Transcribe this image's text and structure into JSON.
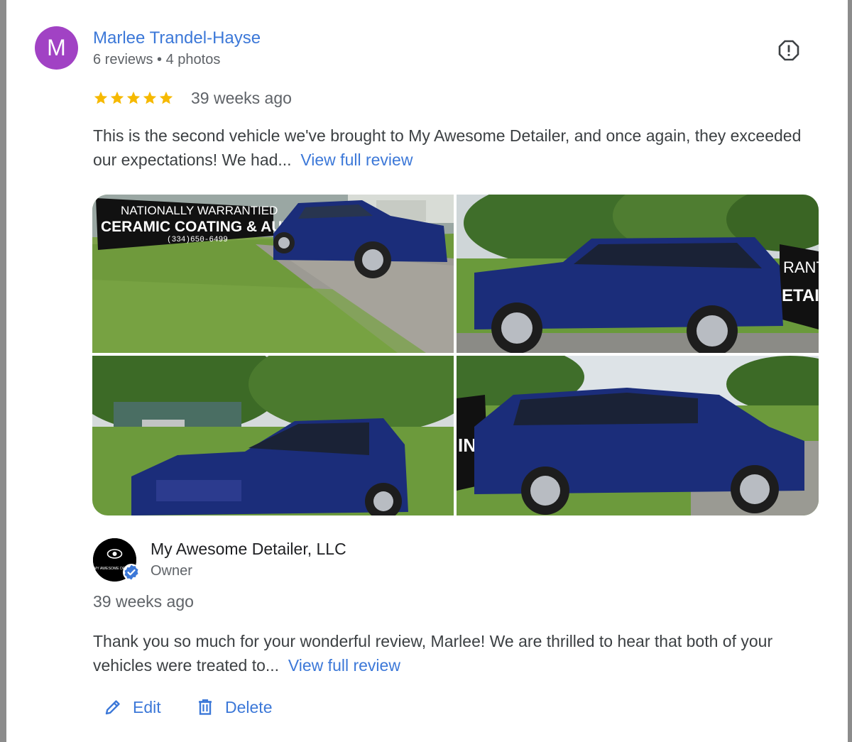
{
  "review": {
    "avatar_letter": "M",
    "reviewer_name": "Marlee Trandel-Hayse",
    "reviewer_meta": "6 reviews • 4 photos",
    "rating": 5,
    "time": "39 weeks ago",
    "text": "This is the second vehicle we've brought to My Awesome Detailer, and once again, they exceeded our expectations! We had...",
    "view_full": "View full review",
    "photo_signage": {
      "line1": "NATIONALLY WARRANTIED",
      "line2": "CERAMIC COATING & AUTO DETAIL",
      "line3": "(334)650-6499",
      "partial_a": "RANTIED",
      "partial_b": "ETAILIN",
      "partial_c": "IN"
    }
  },
  "reply": {
    "owner_name": "My Awesome Detailer, LLC",
    "owner_role": "Owner",
    "logo_text": "MY AWESOME DE",
    "time": "39 weeks ago",
    "text": "Thank you so much for your wonderful review, Marlee! We are thrilled to hear that both of your vehicles were treated to...",
    "view_full": "View full review"
  },
  "actions": {
    "edit": "Edit",
    "delete": "Delete"
  },
  "colors": {
    "link": "#3c78d8",
    "star": "#f6b900",
    "avatar": "#a142c4",
    "car": "#1b2d7a"
  },
  "icons": [
    "report-icon",
    "star-icon",
    "verified-icon",
    "pencil-icon",
    "trash-icon"
  ]
}
